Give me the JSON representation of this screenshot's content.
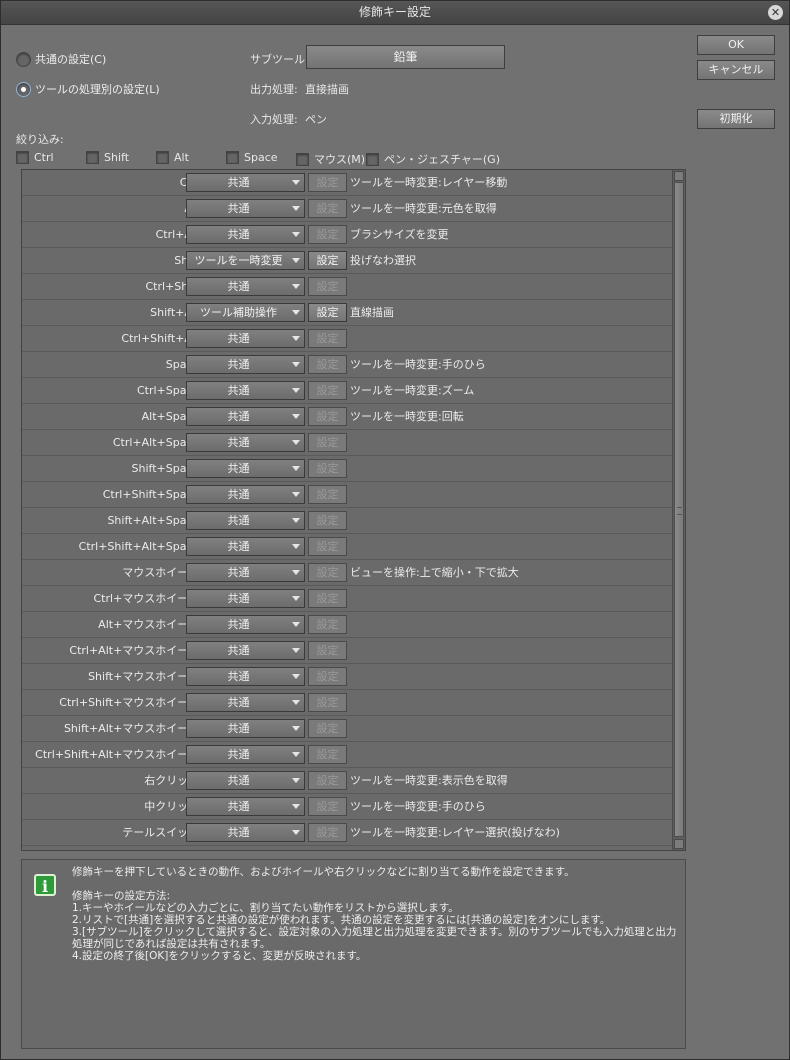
{
  "window": {
    "title": "修飾キー設定"
  },
  "mode": {
    "common_label": "共通の設定(C)",
    "per_tool_label": "ツールの処理別の設定(L)",
    "selected": "per_tool"
  },
  "subtool": {
    "label": "サブツール:",
    "value": "鉛筆"
  },
  "output": {
    "label": "出力処理:",
    "value": "直接描画"
  },
  "input": {
    "label": "入力処理:",
    "value": "ペン"
  },
  "buttons": {
    "ok": "OK",
    "cancel": "キャンセル",
    "reset": "初期化"
  },
  "filter": {
    "label": "絞り込み:",
    "items": [
      {
        "label": "Ctrl",
        "checked": false
      },
      {
        "label": "Shift",
        "checked": false
      },
      {
        "label": "Alt",
        "checked": false
      },
      {
        "label": "Space",
        "checked": false
      },
      {
        "label": "マウス(M)",
        "checked": false
      },
      {
        "label": "ペン・ジェスチャー(G)",
        "checked": false
      }
    ]
  },
  "setting_label": "設定",
  "rows": [
    {
      "key": "Ctrl:",
      "action_type": "共通",
      "setting_enabled": false,
      "action": "ツールを一時変更:レイヤー移動"
    },
    {
      "key": "Alt:",
      "action_type": "共通",
      "setting_enabled": false,
      "action": "ツールを一時変更:元色を取得"
    },
    {
      "key": "Ctrl+Alt:",
      "action_type": "共通",
      "setting_enabled": false,
      "action": "ブラシサイズを変更"
    },
    {
      "key": "Shift:",
      "action_type": "ツールを一時変更",
      "setting_enabled": true,
      "action": "投げなわ選択"
    },
    {
      "key": "Ctrl+Shift:",
      "action_type": "共通",
      "setting_enabled": false,
      "action": ""
    },
    {
      "key": "Shift+Alt:",
      "action_type": "ツール補助操作",
      "setting_enabled": true,
      "action": "直線描画"
    },
    {
      "key": "Ctrl+Shift+Alt:",
      "action_type": "共通",
      "setting_enabled": false,
      "action": ""
    },
    {
      "key": "Space:",
      "action_type": "共通",
      "setting_enabled": false,
      "action": "ツールを一時変更:手のひら"
    },
    {
      "key": "Ctrl+Space:",
      "action_type": "共通",
      "setting_enabled": false,
      "action": "ツールを一時変更:ズーム"
    },
    {
      "key": "Alt+Space:",
      "action_type": "共通",
      "setting_enabled": false,
      "action": "ツールを一時変更:回転"
    },
    {
      "key": "Ctrl+Alt+Space:",
      "action_type": "共通",
      "setting_enabled": false,
      "action": ""
    },
    {
      "key": "Shift+Space:",
      "action_type": "共通",
      "setting_enabled": false,
      "action": ""
    },
    {
      "key": "Ctrl+Shift+Space:",
      "action_type": "共通",
      "setting_enabled": false,
      "action": ""
    },
    {
      "key": "Shift+Alt+Space:",
      "action_type": "共通",
      "setting_enabled": false,
      "action": ""
    },
    {
      "key": "Ctrl+Shift+Alt+Space:",
      "action_type": "共通",
      "setting_enabled": false,
      "action": ""
    },
    {
      "key": "マウスホイール:",
      "action_type": "共通",
      "setting_enabled": false,
      "action": "ビューを操作:上で縮小・下で拡大"
    },
    {
      "key": "Ctrl+マウスホイール:",
      "action_type": "共通",
      "setting_enabled": false,
      "action": ""
    },
    {
      "key": "Alt+マウスホイール:",
      "action_type": "共通",
      "setting_enabled": false,
      "action": ""
    },
    {
      "key": "Ctrl+Alt+マウスホイール:",
      "action_type": "共通",
      "setting_enabled": false,
      "action": ""
    },
    {
      "key": "Shift+マウスホイール:",
      "action_type": "共通",
      "setting_enabled": false,
      "action": ""
    },
    {
      "key": "Ctrl+Shift+マウスホイール:",
      "action_type": "共通",
      "setting_enabled": false,
      "action": ""
    },
    {
      "key": "Shift+Alt+マウスホイール:",
      "action_type": "共通",
      "setting_enabled": false,
      "action": ""
    },
    {
      "key": "Ctrl+Shift+Alt+マウスホイール:",
      "action_type": "共通",
      "setting_enabled": false,
      "action": ""
    },
    {
      "key": "右クリック:",
      "action_type": "共通",
      "setting_enabled": false,
      "action": "ツールを一時変更:表示色を取得"
    },
    {
      "key": "中クリック:",
      "action_type": "共通",
      "setting_enabled": false,
      "action": "ツールを一時変更:手のひら"
    },
    {
      "key": "テールスイッチ:",
      "action_type": "共通",
      "setting_enabled": false,
      "action": "ツールを一時変更:レイヤー選択(投げなわ)"
    }
  ],
  "info": {
    "icon": "info-icon",
    "lines": [
      "修飾キーを押下しているときの動作、およびホイールや右クリックなどに割り当てる動作を設定できます。",
      "",
      "修飾キーの設定方法:",
      "1.キーやホイールなどの入力ごとに、割り当てたい動作をリストから選択します。",
      "2.リストで[共通]を選択すると共通の設定が使われます。共通の設定を変更するには[共通の設定]をオンにします。",
      "3.[サブツール]をクリックして選択すると、設定対象の入力処理と出力処理を変更できます。別のサブツールでも入力処理と出力処理が同じであれば設定は共有されます。",
      "4.設定の終了後[OK]をクリックすると、変更が反映されます。"
    ]
  }
}
